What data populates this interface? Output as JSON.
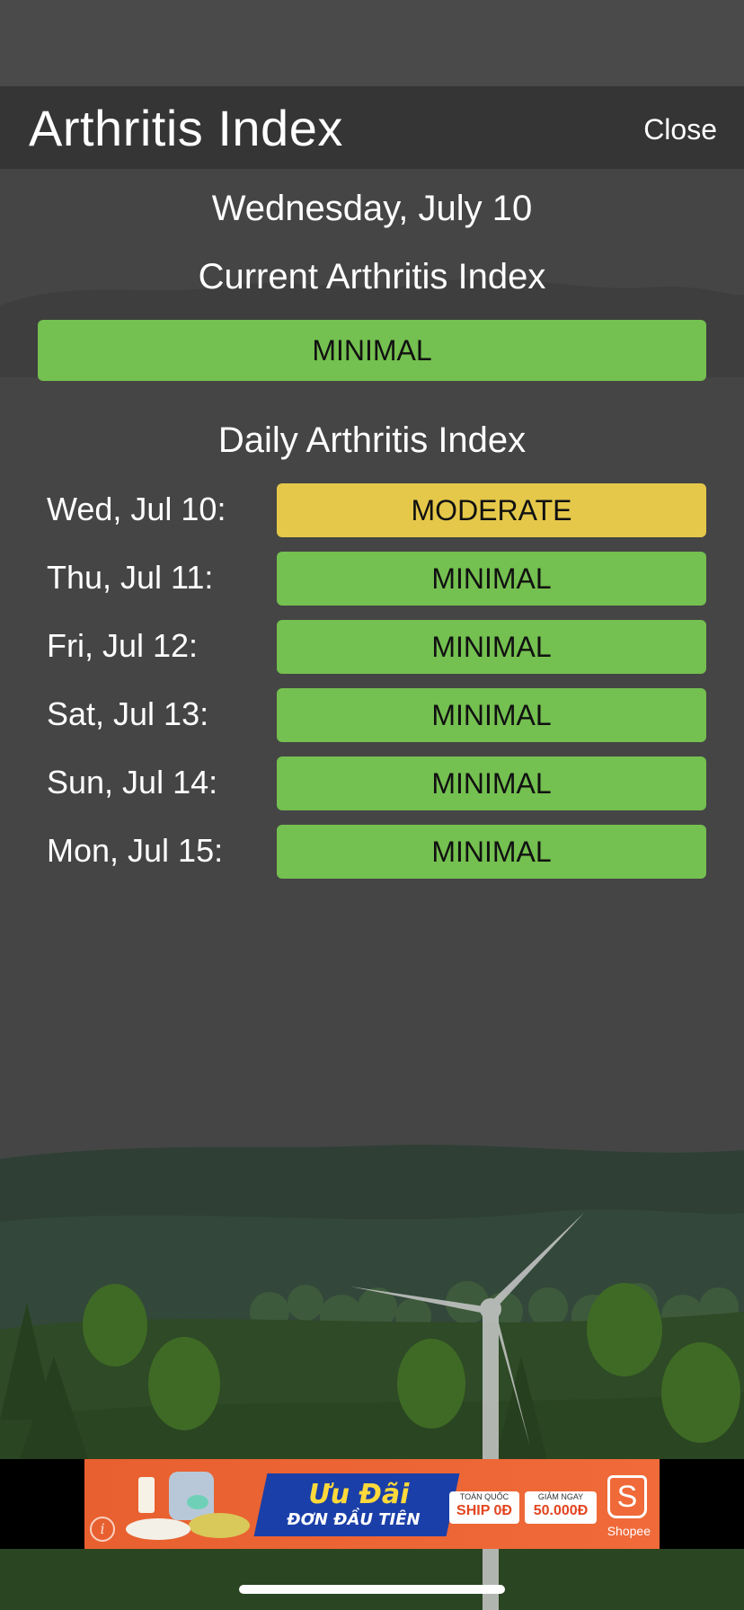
{
  "header": {
    "title": "Arthritis Index",
    "close_label": "Close"
  },
  "date": "Wednesday, July 10",
  "current": {
    "title": "Current Arthritis Index",
    "level": "MINIMAL",
    "color": "#74c050"
  },
  "daily": {
    "title": "Daily Arthritis Index",
    "days": [
      {
        "label": "Wed, Jul 10:",
        "level": "MODERATE",
        "color": "#e5c84a"
      },
      {
        "label": "Thu, Jul 11:",
        "level": "MINIMAL",
        "color": "#74c050"
      },
      {
        "label": "Fri, Jul 12:",
        "level": "MINIMAL",
        "color": "#74c050"
      },
      {
        "label": "Sat, Jul 13:",
        "level": "MINIMAL",
        "color": "#74c050"
      },
      {
        "label": "Sun, Jul 14:",
        "level": "MINIMAL",
        "color": "#74c050"
      },
      {
        "label": "Mon, Jul 15:",
        "level": "MINIMAL",
        "color": "#74c050"
      }
    ]
  },
  "ad": {
    "headline_1": "Ưu Đãi",
    "headline_2": "ĐƠN ĐẦU TIÊN",
    "badge_1_small": "TOÀN QUỐC",
    "badge_1_big": "SHIP 0Đ",
    "badge_2_small": "GIẢM NGAY",
    "badge_2_big": "50.000Đ",
    "brand_glyph": "S",
    "brand": "Shopee",
    "info_glyph": "i"
  }
}
